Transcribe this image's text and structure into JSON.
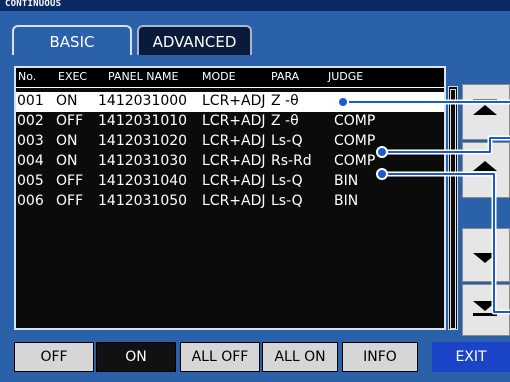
{
  "window": {
    "title": "CONTINUOUS"
  },
  "tabs": [
    {
      "label": "BASIC",
      "active": true
    },
    {
      "label": "ADVANCED",
      "active": false
    }
  ],
  "table": {
    "columns": [
      "No.",
      "EXEC",
      "PANEL NAME",
      "MODE",
      "PARA",
      "JUDGE"
    ],
    "rows": [
      {
        "no": "001",
        "exec": "ON",
        "panel": "1412031000",
        "mode": "LCR+ADJ",
        "para": "Z -θ",
        "judge": "",
        "selected": true
      },
      {
        "no": "002",
        "exec": "OFF",
        "panel": "1412031010",
        "mode": "LCR+ADJ",
        "para": "Z -θ",
        "judge": "COMP",
        "selected": false
      },
      {
        "no": "003",
        "exec": "ON",
        "panel": "1412031020",
        "mode": "LCR+ADJ",
        "para": "Ls-Q",
        "judge": "COMP",
        "selected": false
      },
      {
        "no": "004",
        "exec": "ON",
        "panel": "1412031030",
        "mode": "LCR+ADJ",
        "para": "Rs-Rd",
        "judge": "COMP",
        "selected": false
      },
      {
        "no": "005",
        "exec": "OFF",
        "panel": "1412031040",
        "mode": "LCR+ADJ",
        "para": "Ls-Q",
        "judge": "BIN",
        "selected": false
      },
      {
        "no": "006",
        "exec": "OFF",
        "panel": "1412031050",
        "mode": "LCR+ADJ",
        "para": "Ls-Q",
        "judge": "BIN",
        "selected": false
      }
    ]
  },
  "scroll_buttons": [
    {
      "icon": "page-up-icon"
    },
    {
      "icon": "up-icon"
    },
    {
      "icon": "down-icon"
    },
    {
      "icon": "page-down-icon"
    }
  ],
  "footer": {
    "off_label": "OFF",
    "on_label": "ON",
    "all_off_label": "ALL OFF",
    "all_on_label": "ALL ON",
    "info_label": "INFO",
    "exit_label": "EXIT"
  },
  "colors": {
    "background": "#2a61a8",
    "title_bar": "#0a2a66",
    "exit": "#1c44c8",
    "selected_row": "#ffffff"
  }
}
